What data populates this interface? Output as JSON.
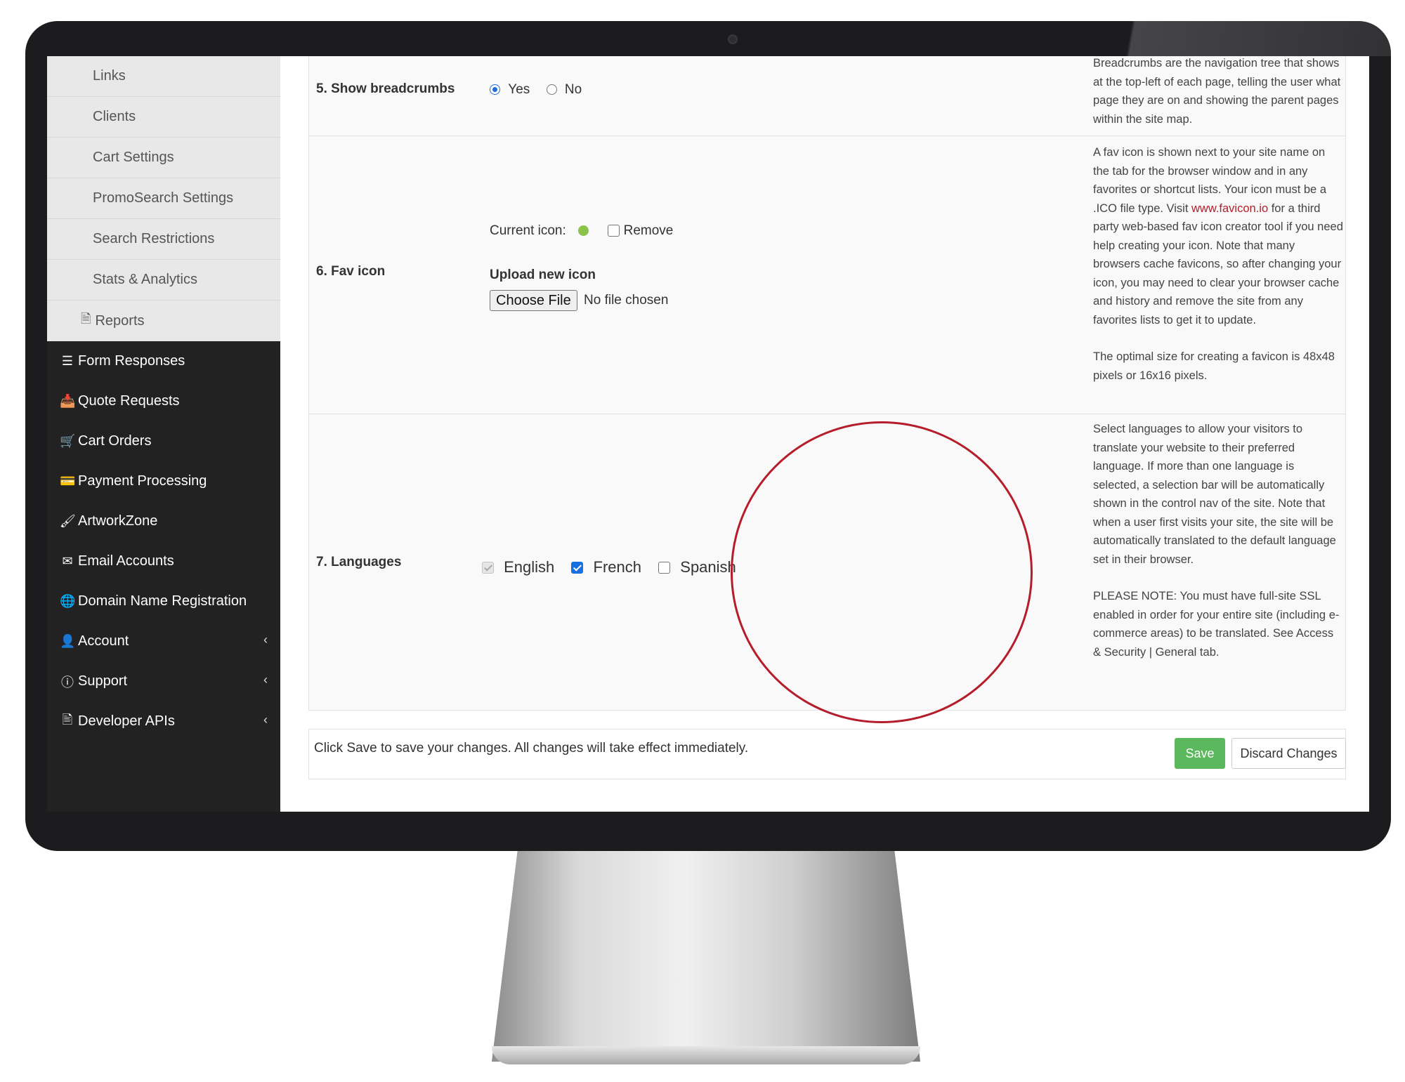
{
  "sidebar": {
    "sub_items": [
      {
        "label": "Links"
      },
      {
        "label": "Clients"
      },
      {
        "label": "Cart Settings"
      },
      {
        "label": "PromoSearch Settings"
      },
      {
        "label": "Search Restrictions"
      },
      {
        "label": "Stats & Analytics"
      },
      {
        "label": "Reports",
        "icon": "document-icon"
      }
    ],
    "items": [
      {
        "label": "Form Responses",
        "icon": "list-icon"
      },
      {
        "label": "Quote Requests",
        "icon": "inbox-icon"
      },
      {
        "label": "Cart Orders",
        "icon": "cart-icon"
      },
      {
        "label": "Payment Processing",
        "icon": "credit-card-icon"
      },
      {
        "label": "ArtworkZone",
        "icon": "brush-icon"
      },
      {
        "label": "Email Accounts",
        "icon": "envelope-icon"
      },
      {
        "label": "Domain Name Registration",
        "icon": "globe-icon"
      },
      {
        "label": "Account",
        "icon": "user-icon",
        "has_submenu": true
      },
      {
        "label": "Support",
        "icon": "info-icon",
        "has_submenu": true
      },
      {
        "label": "Developer APIs",
        "icon": "code-file-icon",
        "has_submenu": true
      }
    ]
  },
  "settings": {
    "breadcrumbs": {
      "label": "5. Show breadcrumbs",
      "yes_label": "Yes",
      "no_label": "No",
      "selected": "Yes",
      "description": "Breadcrumbs are the navigation tree that shows at the top-left of each page, telling the user what page they are on and showing the parent pages within the site map."
    },
    "favicon": {
      "label": "6. Fav icon",
      "current_icon_label": "Current icon:",
      "remove_label": "Remove",
      "upload_label": "Upload new icon",
      "choose_file_label": "Choose File",
      "no_file_label": "No file chosen",
      "desc_part1": "A fav icon is shown next to your site name on the tab for the browser window and in any favorites or shortcut lists.  Your icon must be a .ICO file type.  Visit ",
      "desc_link": "www.favicon.io",
      "desc_part2": " for a third party web-based fav icon creator tool if you need help creating your icon.  Note that many browsers cache favicons, so after changing your icon, you may need to clear your browser cache and history and remove the site from any favorites lists to get it to update.",
      "desc_size": "The optimal size for creating a favicon is 48x48 pixels or 16x16 pixels."
    },
    "languages": {
      "label": "7. Languages",
      "options": [
        {
          "label": "English",
          "state": "checked-disabled"
        },
        {
          "label": "French",
          "state": "checked"
        },
        {
          "label": "Spanish",
          "state": "unchecked"
        }
      ],
      "description": "Select languages to allow your visitors to translate your website to their preferred language. If more than one language is selected, a selection bar will be automatically shown in the control nav of the site. Note that when a user first visits your site, the site will be automatically translated to the default language set in their browser.",
      "note": "PLEASE NOTE: You must have full-site SSL enabled in order for your entire site (including e-commerce areas) to be translated. See Access & Security | General tab."
    }
  },
  "save_bar": {
    "message": "Click Save to save your changes. All changes will take effect immediately.",
    "save_label": "Save",
    "discard_label": "Discard Changes"
  },
  "colors": {
    "sidebar_bg": "#222222",
    "save_green": "#5cb85c",
    "link_red": "#b0202a",
    "highlight_circle": "#b51d2a"
  }
}
